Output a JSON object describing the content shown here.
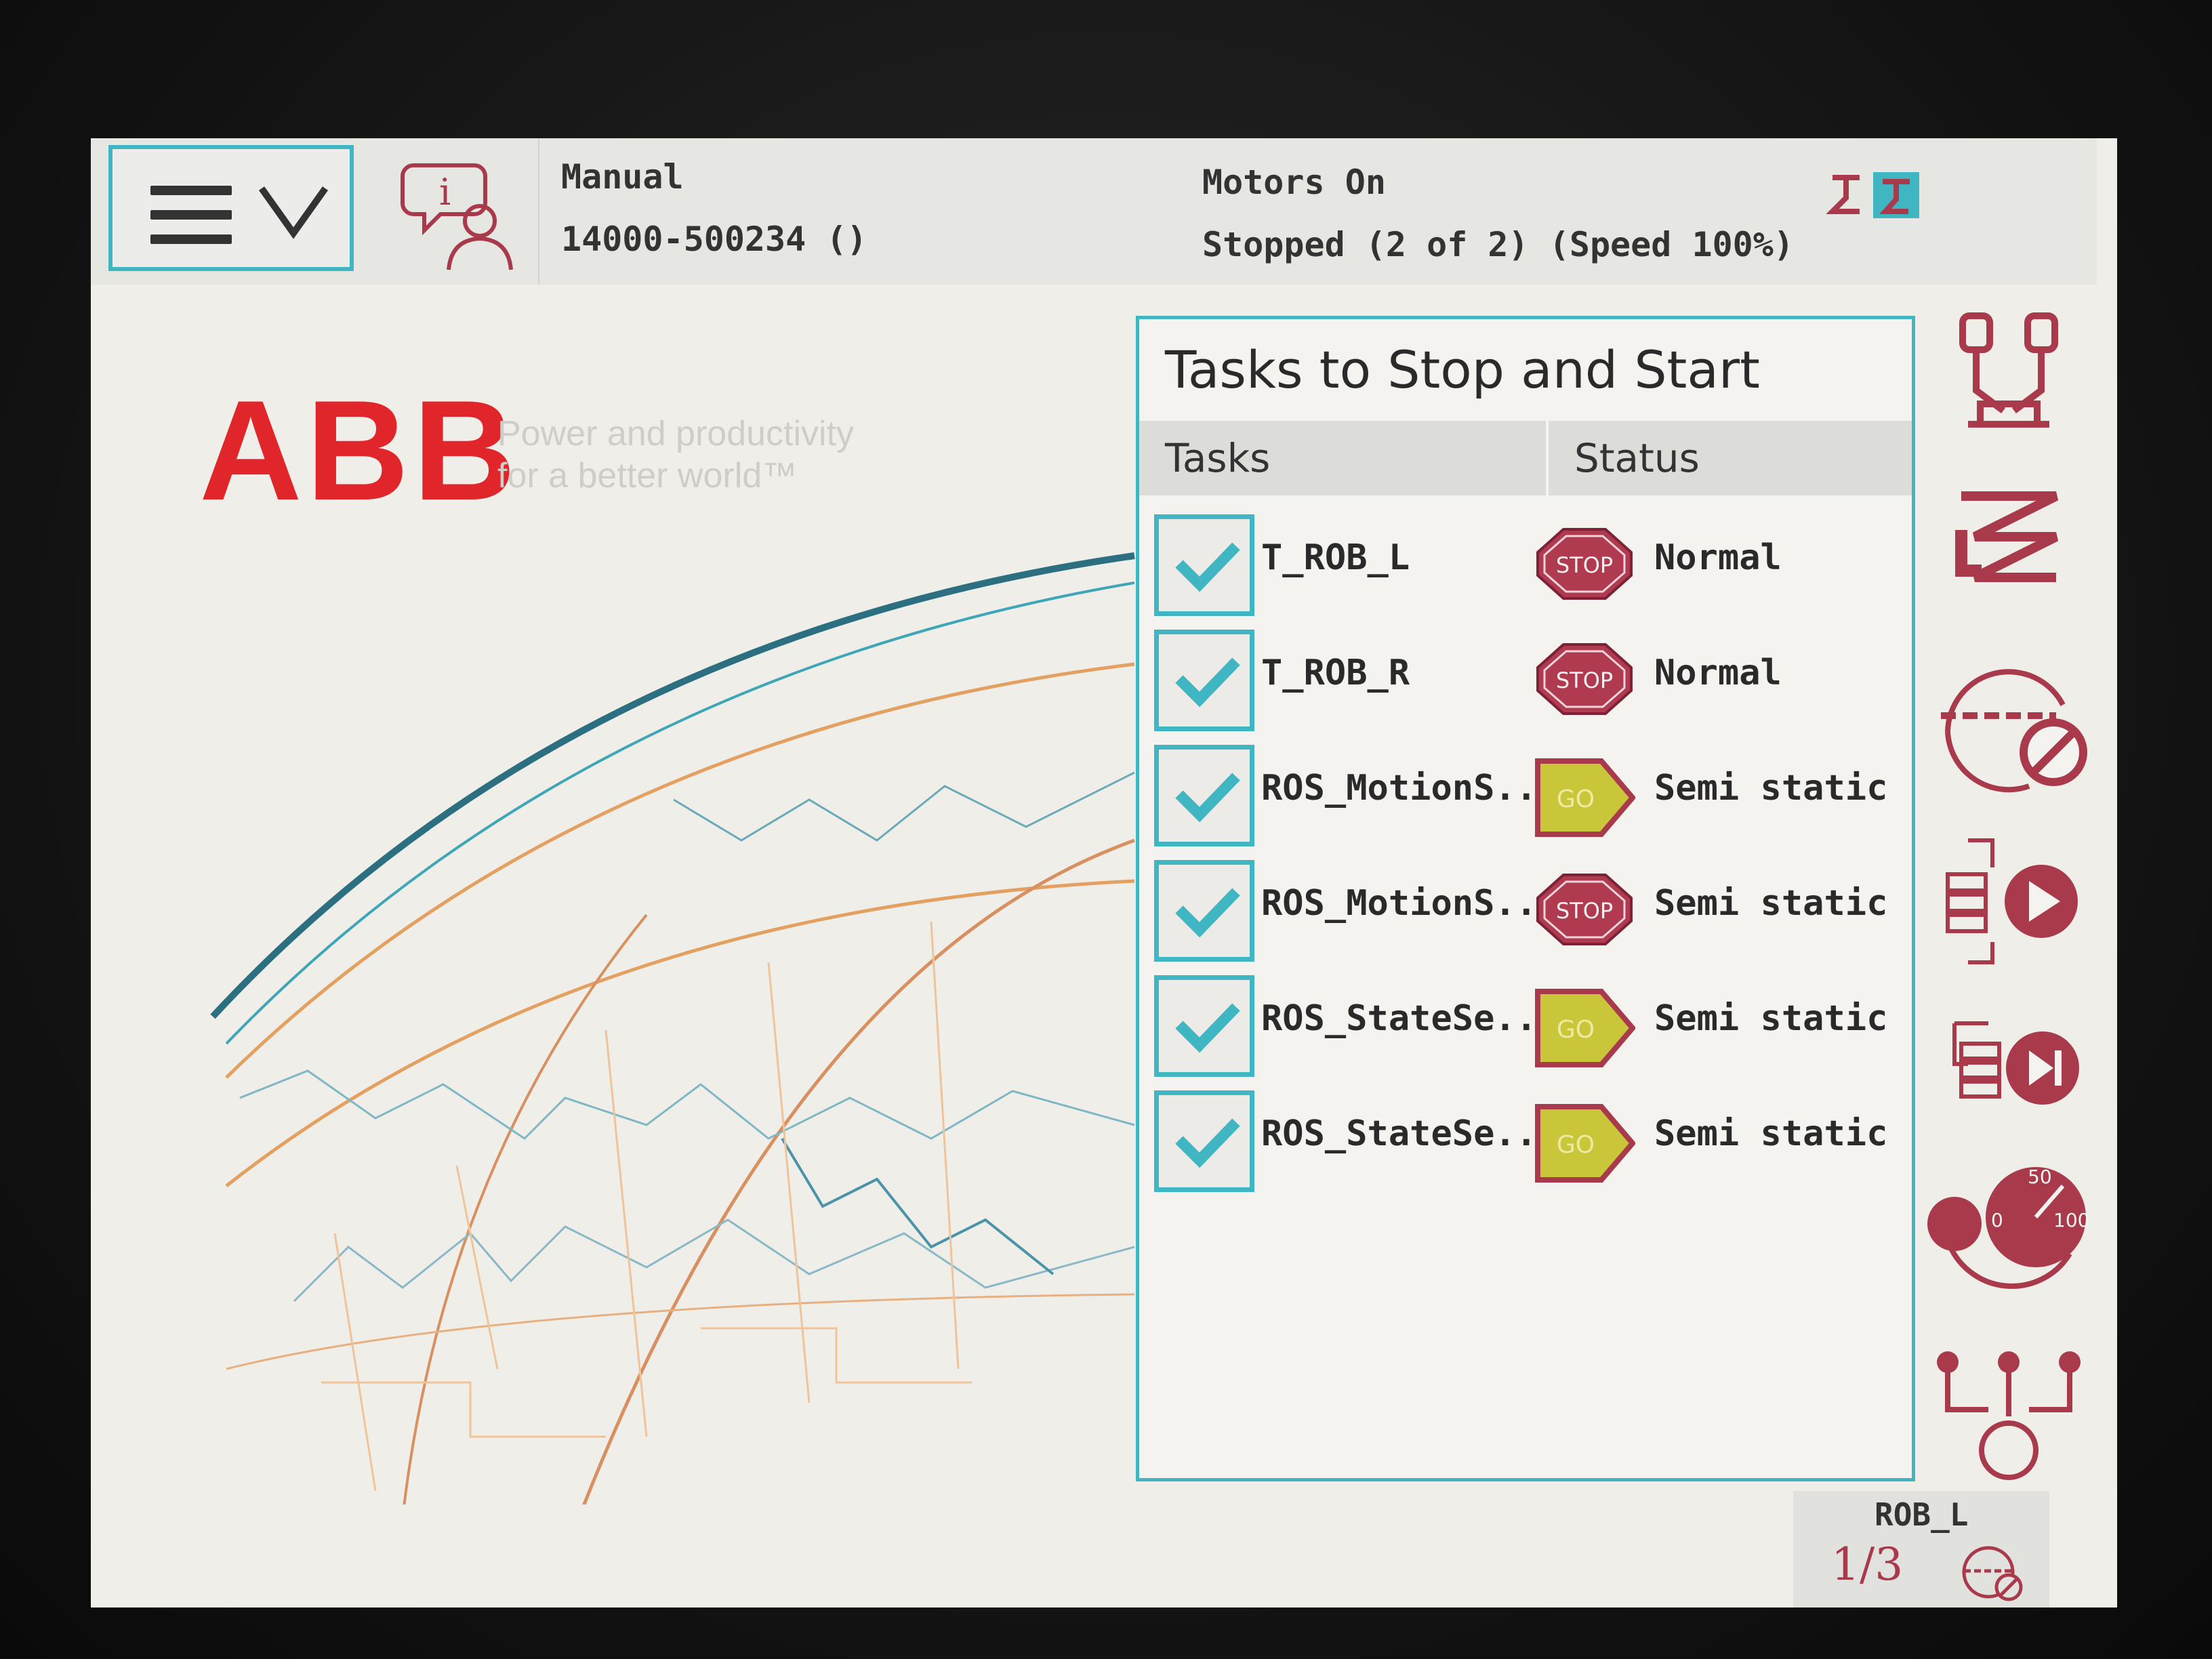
{
  "header": {
    "mode": "Manual",
    "controller_id": "14000-500234 ()",
    "motor_state": "Motors On",
    "run_state": "Stopped (2 of 2) (Speed 100%)",
    "menu_icon": "hamburger-menu-icon",
    "info_icon": "event-log-icon"
  },
  "brand": {
    "logo": "ABB",
    "tagline_line1": "Power and productivity",
    "tagline_line2": "for a better world™"
  },
  "tasks_panel": {
    "title": "Tasks to Stop and Start",
    "col_tasks": "Tasks",
    "col_status": "Status",
    "rows": [
      {
        "name": "T_ROB_L",
        "checked": true,
        "icon": "stop",
        "status": "Normal"
      },
      {
        "name": "T_ROB_R",
        "checked": true,
        "icon": "stop",
        "status": "Normal"
      },
      {
        "name": "ROS_MotionS...",
        "checked": true,
        "icon": "go",
        "status": "Semi static"
      },
      {
        "name": "ROS_MotionS...",
        "checked": true,
        "icon": "stop",
        "status": "Semi static"
      },
      {
        "name": "ROS_StateSe...",
        "checked": true,
        "icon": "go",
        "status": "Semi static"
      },
      {
        "name": "ROS_StateSe...",
        "checked": true,
        "icon": "go",
        "status": "Semi static"
      }
    ],
    "stop_label": "STOP",
    "go_label": "GO"
  },
  "toolbar": [
    "robot-mechanical-unit-icon",
    "jog-motion-mode-icon",
    "increment-disabled-icon",
    "run-program-icon",
    "step-program-icon",
    "speed-gauge-icon",
    "tasks-icon"
  ],
  "speed_gauge_labels": [
    "50",
    "0",
    "100"
  ],
  "status_bar": {
    "robot": "ROB_L",
    "unit_fraction": "1/3"
  },
  "colors": {
    "accent": "#3fb6c2",
    "abb_red": "#e0262b",
    "stop_red": "#b03a50",
    "go_yellow": "#c9c63a",
    "icon_maroon": "#a83a4c"
  }
}
